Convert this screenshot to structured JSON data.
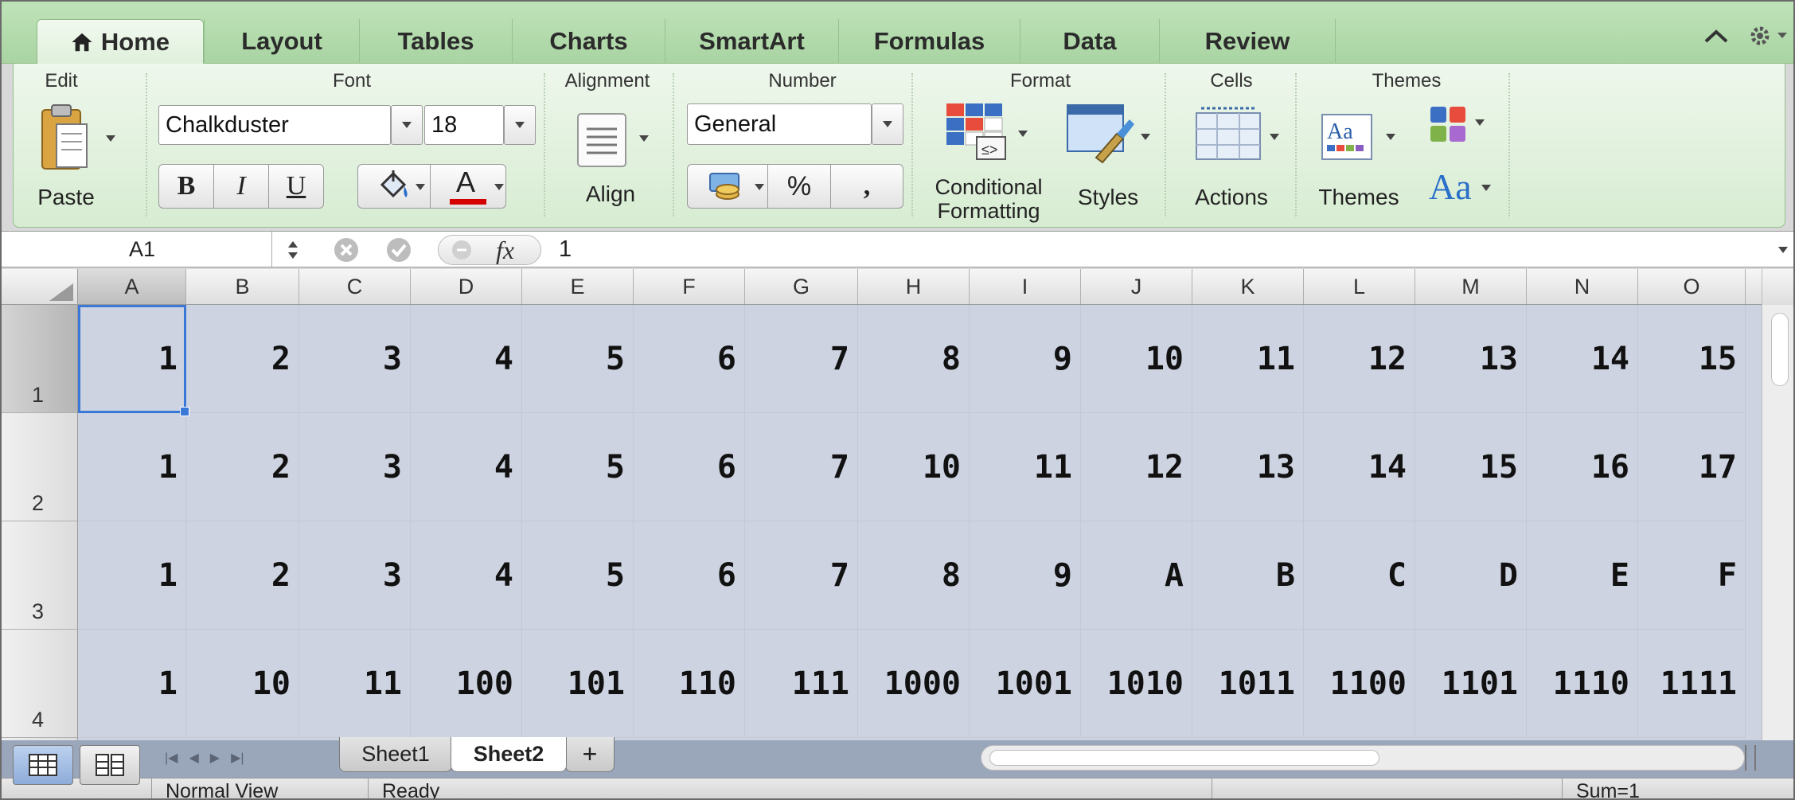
{
  "tabs": [
    {
      "label": "Home",
      "active": true
    },
    {
      "label": "Layout"
    },
    {
      "label": "Tables"
    },
    {
      "label": "Charts"
    },
    {
      "label": "SmartArt"
    },
    {
      "label": "Formulas"
    },
    {
      "label": "Data"
    },
    {
      "label": "Review"
    }
  ],
  "ribbon": {
    "groups": {
      "edit": "Edit",
      "font": "Font",
      "alignment": "Alignment",
      "number": "Number",
      "format": "Format",
      "cells": "Cells",
      "themes": "Themes"
    },
    "paste_label": "Paste",
    "font_name": "Chalkduster",
    "font_size": "18",
    "bold": "B",
    "italic": "I",
    "underline": "U",
    "font_color_letter": "A",
    "align_label": "Align",
    "number_format": "General",
    "percent": "%",
    "comma": ",",
    "conditional_formatting_line1": "Conditional",
    "conditional_formatting_line2": "Formatting",
    "styles_label": "Styles",
    "actions_label": "Actions",
    "themes_label": "Themes",
    "theme_fonts_label": "Aa",
    "accent_color": "#d40000"
  },
  "formula_bar": {
    "cell_ref": "A1",
    "fx": "fx",
    "value": "1"
  },
  "columns": [
    "A",
    "B",
    "C",
    "D",
    "E",
    "F",
    "G",
    "H",
    "I",
    "J",
    "K",
    "L",
    "M",
    "N",
    "O"
  ],
  "rows": [
    {
      "num": "1",
      "cells": [
        "1",
        "2",
        "3",
        "4",
        "5",
        "6",
        "7",
        "8",
        "9",
        "10",
        "11",
        "12",
        "13",
        "14",
        "15"
      ]
    },
    {
      "num": "2",
      "cells": [
        "1",
        "2",
        "3",
        "4",
        "5",
        "6",
        "7",
        "10",
        "11",
        "12",
        "13",
        "14",
        "15",
        "16",
        "17"
      ]
    },
    {
      "num": "3",
      "cells": [
        "1",
        "2",
        "3",
        "4",
        "5",
        "6",
        "7",
        "8",
        "9",
        "A",
        "B",
        "C",
        "D",
        "E",
        "F"
      ]
    },
    {
      "num": "4",
      "cells": [
        "1",
        "10",
        "11",
        "100",
        "101",
        "110",
        "111",
        "1000",
        "1001",
        "1010",
        "1011",
        "1100",
        "1101",
        "1110",
        "1111"
      ]
    }
  ],
  "sheets": [
    {
      "label": "Sheet1"
    },
    {
      "label": "Sheet2",
      "active": true
    }
  ],
  "add_sheet": "+",
  "status": {
    "view": "Normal View",
    "mode": "Ready",
    "sum": "Sum=1"
  }
}
